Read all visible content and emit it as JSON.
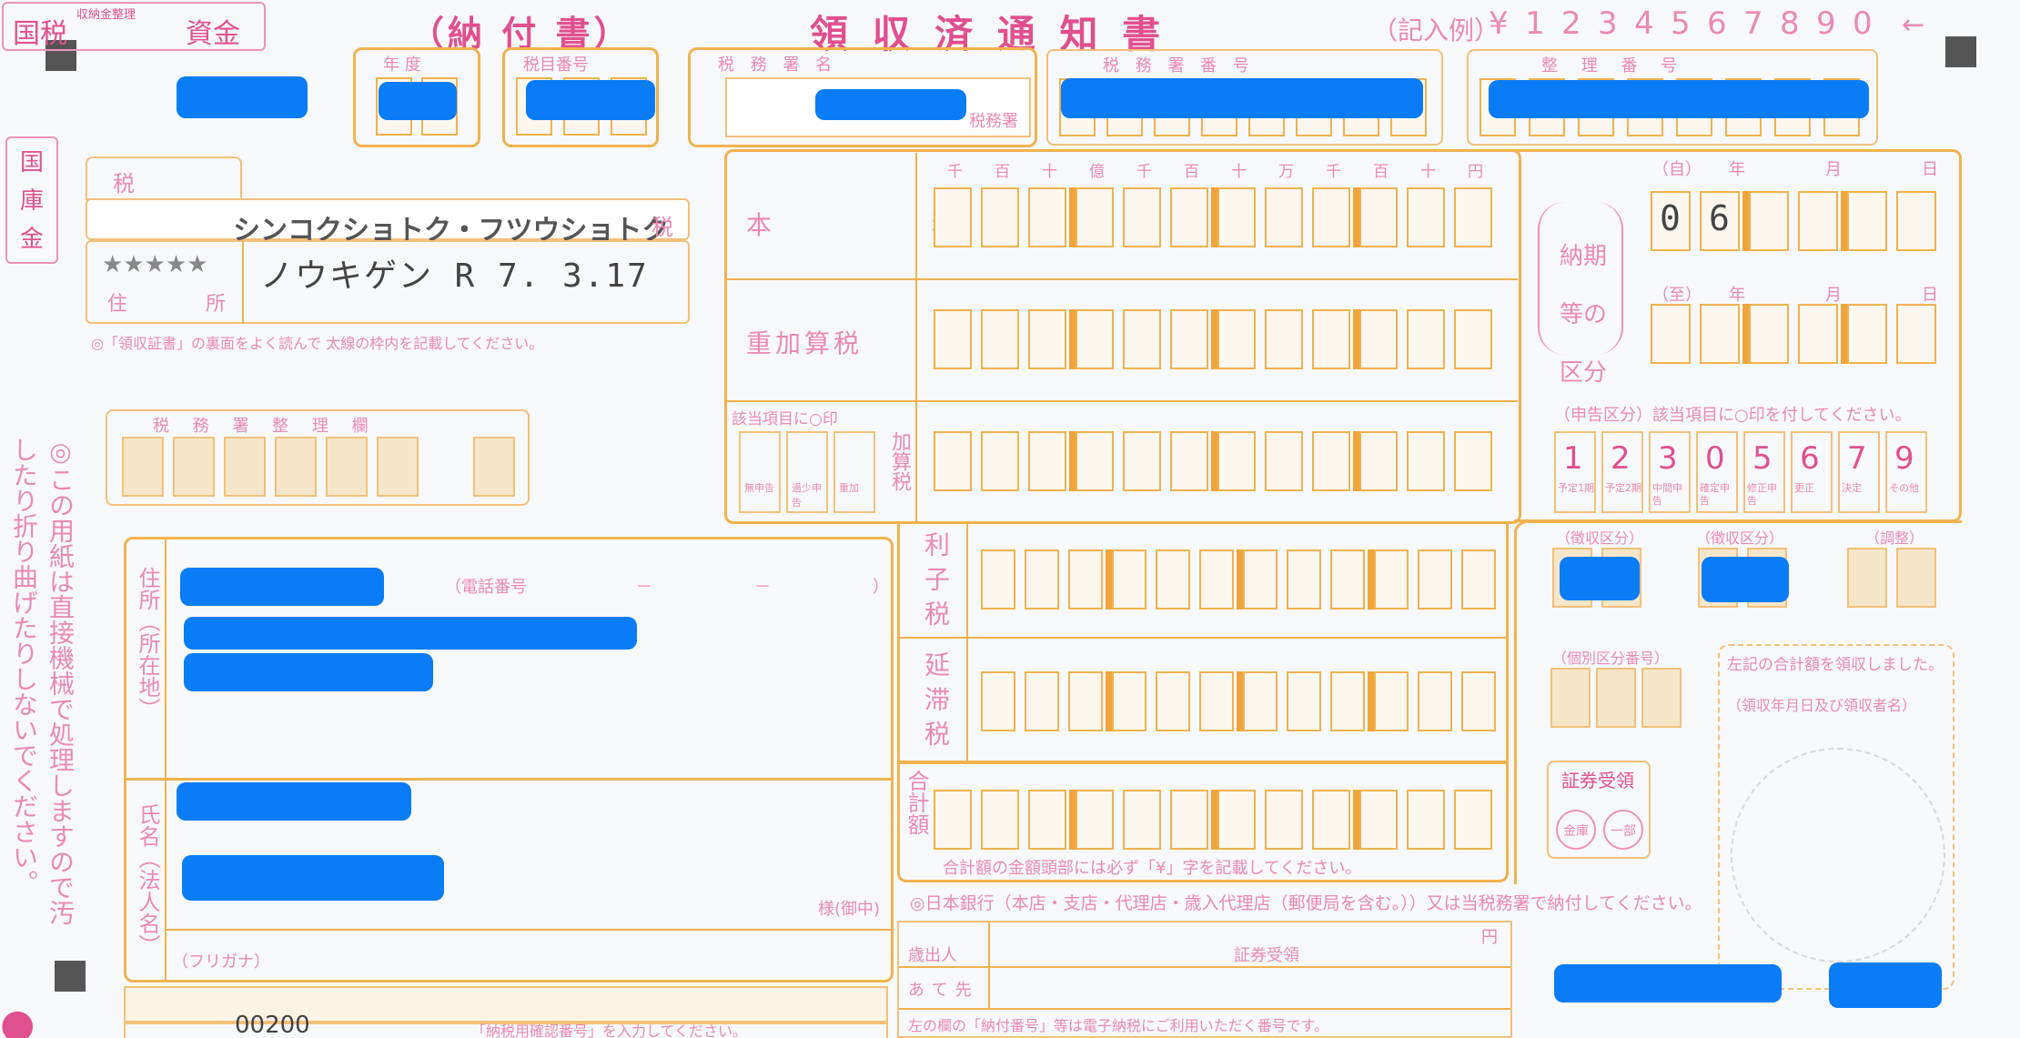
{
  "header": {
    "form_label_1": "国税",
    "form_label_2": "資金",
    "form_label_small": "収納金整理",
    "notice_type": "（納 付 書）",
    "title": "領 収 済 通 知 書",
    "example_label": "（記入例）",
    "example_digits": [
      "¥",
      "1",
      "2",
      "3",
      "4",
      "5",
      "6",
      "7",
      "8",
      "9",
      "0"
    ],
    "field_year": "年 度",
    "field_tax_code": "税目番号",
    "field_tax_office_name": "税 務 署 名",
    "tax_office_suffix": "税務署",
    "field_tax_office_number": "税 務 署 番 号",
    "field_reference_number": "整 理 番 号"
  },
  "left": {
    "kokkokin": "国庫金",
    "tax_item_label": "税 目",
    "tax_item_value": "シンコクショトク・フツウショトク",
    "tax_item_suffix": "税",
    "stars": "★★★★★",
    "star_label_1": "住",
    "star_label_2": "所",
    "deadline_text": "ノウキゲン R 7. 3.17",
    "note": "◎「領収証書」の裏面をよく読んで 太線の枠内を記載してください。",
    "tax_office_use": "税 務 署 整 理 欄",
    "address_label": "住所（所在地）",
    "phone_label": "（電話番号",
    "phone_sep": "－　　　　－　　　　）",
    "name_label": "氏名（法人名）",
    "furigana": "（フリガナ）",
    "sama": "様(御中)",
    "vertical_notice": "◎この用紙は直接機械で処理しますので汚したり折り曲げたりしないでください。",
    "bottom_code": "00200",
    "bottom_note": "「納税用確認番号」を入力してください。"
  },
  "amounts": {
    "digit_units": [
      "千",
      "百",
      "十",
      "億",
      "千",
      "百",
      "十",
      "万",
      "千",
      "百",
      "十",
      "円"
    ],
    "rows": [
      {
        "label": "本　　税"
      },
      {
        "label": "重加算税"
      },
      {
        "label": "加算税"
      },
      {
        "label": "利子税"
      },
      {
        "label": "延滞税"
      },
      {
        "label": "合計額"
      }
    ],
    "applicable_label": "該当項目に○印",
    "kasanzei_options": [
      "無申告",
      "過少申告",
      "重加"
    ],
    "total_note": "合計額の金額頭部には必ず「¥」字を記載してください。",
    "bank_note": "◎日本銀行（本店・支店・代理店・歳入代理店（郵便局を含む。））又は当税務署で納付してください。",
    "payee_label": "歳出人",
    "yen": "円",
    "securities_label": "証券受領",
    "ateire": "あて先",
    "bottom_instruction": "左の欄の「納付番号」等は電子納税にご利用いただく番号です。"
  },
  "period": {
    "label": "納期等の区分",
    "from": "（自）",
    "to": "（至）",
    "year": "年",
    "month": "月",
    "day": "日",
    "from_digits": [
      "0",
      "6"
    ],
    "declaration_label": "（申告区分）該当項目に○印を付してください。",
    "declaration_options": [
      {
        "num": "1",
        "sub": "予定1期"
      },
      {
        "num": "2",
        "sub": "予定2期"
      },
      {
        "num": "3",
        "sub": "中間申告"
      },
      {
        "num": "0",
        "sub": "確定申告"
      },
      {
        "num": "5",
        "sub": "修正申告"
      },
      {
        "num": "6",
        "sub": "更正"
      },
      {
        "num": "7",
        "sub": "決定"
      },
      {
        "num": "9",
        "sub": "その他"
      }
    ],
    "lower_label_1": "（徴収区分）",
    "lower_label_2": "（徴収区分）",
    "lower_label_3": "（調整）",
    "bank_code_label": "（個別区分番号）",
    "receipt_label": "左記の合計額を領収しました。",
    "receipt_sub": "（領収年月日及び領収者名）",
    "securities_stamp": "証券受領",
    "stamp_left": "金庫",
    "stamp_right": "一部"
  }
}
